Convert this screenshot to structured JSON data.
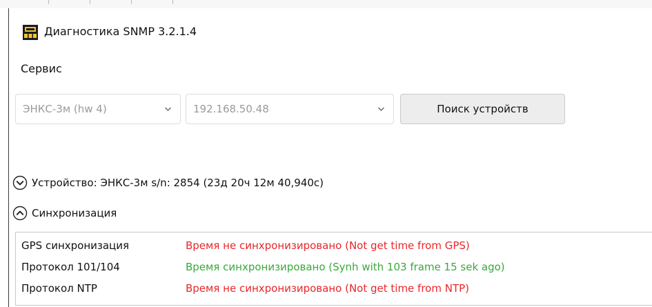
{
  "window": {
    "title": "Диагностика SNMP 3.2.1.4",
    "icon": "network-device-icon"
  },
  "menu": {
    "service_label": "Сервис"
  },
  "toolbar": {
    "device_select_value": "ЭНКС-3м (hw 4)",
    "ip_select_value": "192.168.50.48",
    "search_button_label": "Поиск устройств"
  },
  "device_section": {
    "label": "Устройство: ЭНКС-3м s/n: 2854 (23д 20ч 12м 40,940с)",
    "state": "collapsed",
    "icon": "chevron-down-circle-icon"
  },
  "sync_section": {
    "label": "Синхронизация",
    "state": "expanded",
    "icon": "chevron-up-circle-icon",
    "rows": [
      {
        "name": "GPS синхронизация",
        "status": "Время не синхронизировано (Not get time from GPS)",
        "color": "#e8262a"
      },
      {
        "name": "Протокол 101/104",
        "status": "Время синхронизировано (Synh with 103 frame 15 sek ago)",
        "color": "#3aa83a"
      },
      {
        "name": "Протокол NTP",
        "status": "Время не синхронизировано (Not get time from NTP)",
        "color": "#e8262a"
      }
    ]
  }
}
